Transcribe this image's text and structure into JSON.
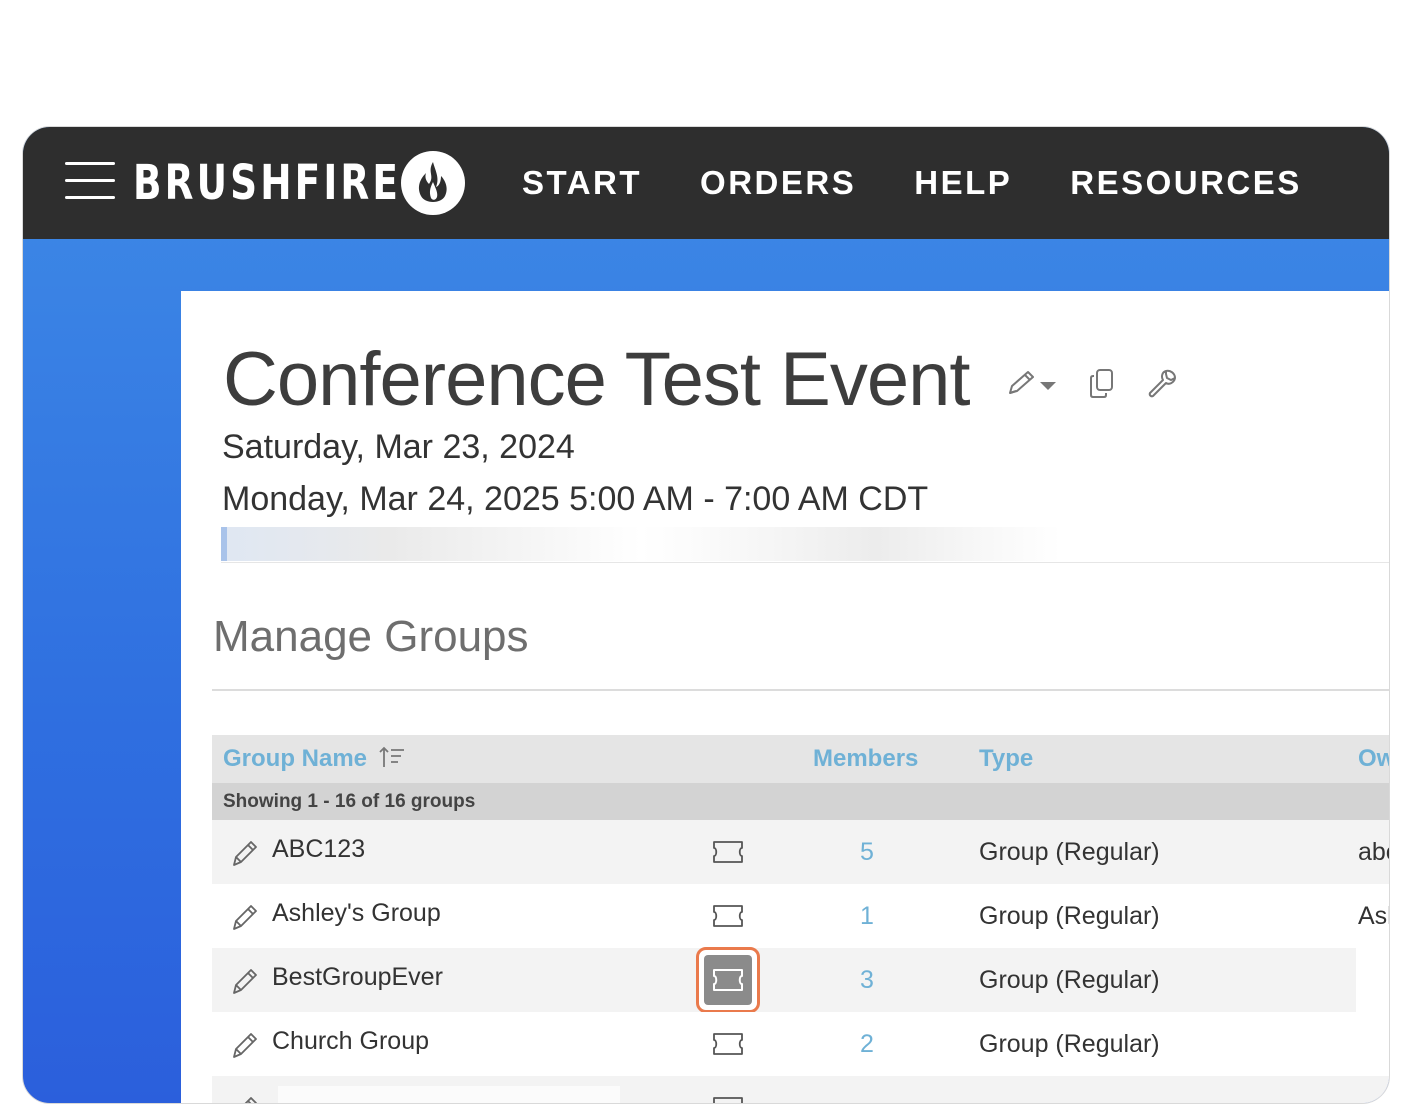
{
  "app": {
    "brand": "BRUSHFIRE",
    "nav": [
      "START",
      "ORDERS",
      "HELP",
      "RESOURCES"
    ]
  },
  "event": {
    "title": "Conference Test Event",
    "date_line1": "Saturday, Mar 23, 2024",
    "date_line2": "Monday, Mar 24, 2025 5:00 AM - 7:00 AM CDT"
  },
  "section": {
    "title": "Manage Groups"
  },
  "table": {
    "columns": {
      "group_name": "Group Name",
      "members": "Members",
      "type": "Type",
      "owner": "Ow"
    },
    "showing": "Showing 1 - 16 of 16 groups",
    "rows": [
      {
        "name": "ABC123",
        "members": "5",
        "type": "Group (Regular)",
        "owner": "abc"
      },
      {
        "name": "Ashley's Group",
        "members": "1",
        "type": "Group (Regular)",
        "owner": "Ash"
      },
      {
        "name": "BestGroupEver",
        "members": "3",
        "type": "Group (Regular)",
        "owner": ""
      },
      {
        "name": "Church Group",
        "members": "2",
        "type": "Group (Regular)",
        "owner": ""
      }
    ]
  },
  "colors": {
    "topbar": "#2e2e2e",
    "accent_blue": "#3e8ae6",
    "link": "#6fb1d6",
    "highlight": "#ea7a4c"
  },
  "icons": [
    "hamburger-menu-icon",
    "flame-logo-icon",
    "pencil-dropdown-icon",
    "copy-icon",
    "wrench-icon",
    "sort-ascending-icon",
    "pencil-icon",
    "ticket-icon"
  ]
}
